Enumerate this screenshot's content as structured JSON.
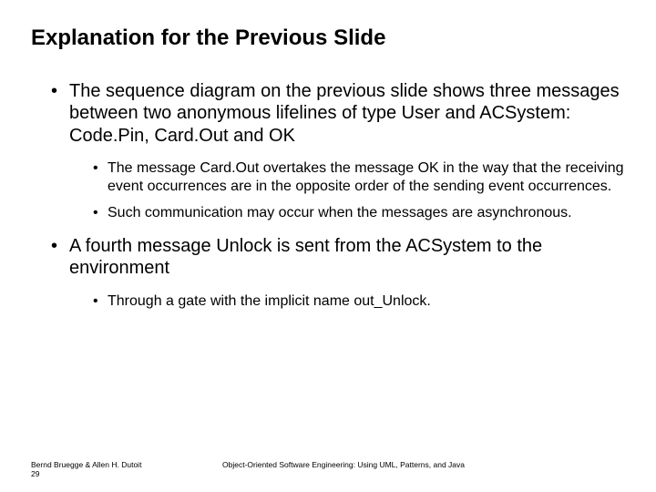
{
  "title": "Explanation for the Previous Slide",
  "bullets": {
    "b1": "The sequence diagram on the previous slide shows three messages between two anonymous lifelines of type User and ACSystem: Code.Pin, Card.Out and OK",
    "b1s1": "The message Card.Out overtakes the message OK in the way that the receiving event occurrences are in the opposite order of the sending event occurrences.",
    "b1s2": "Such communication may occur when the messages are asynchronous.",
    "b2": "A fourth message Unlock is sent from the ACSystem to the environment",
    "b2s1": "Through a gate with the implicit name out_Unlock."
  },
  "footer": {
    "authors": "Bernd Bruegge & Allen H. Dutoit",
    "page": "29",
    "book": "Object-Oriented Software Engineering: Using UML, Patterns, and Java"
  }
}
